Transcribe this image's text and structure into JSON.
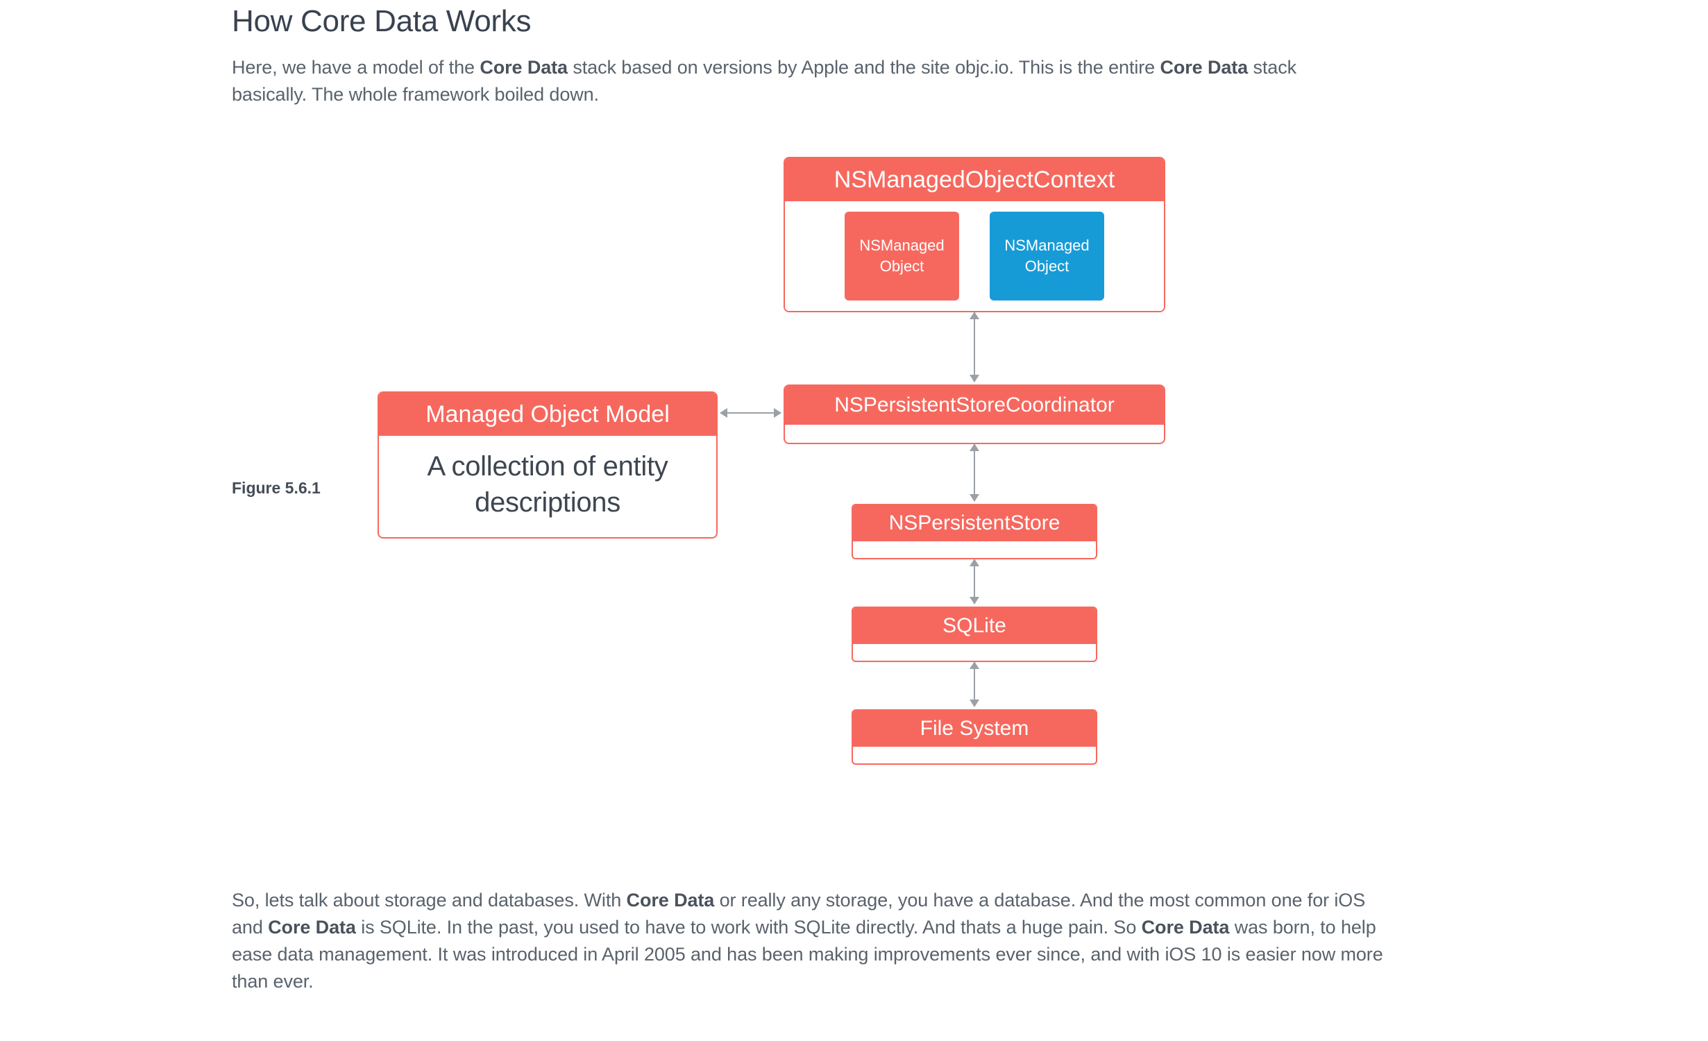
{
  "heading": "How Core Data Works",
  "intro": {
    "pre1": "Here, we have a model of the ",
    "bold1": "Core Data",
    "mid1": " stack based on versions by Apple and the site objc.io. This is the entire ",
    "bold2": "Core Data",
    "post1": " stack basically. The whole framework boiled down."
  },
  "figure_label": "Figure 5.6.1",
  "diagram": {
    "context": {
      "title": "NSManagedObjectContext",
      "inner_left": {
        "line1": "NSManaged",
        "line2": "Object"
      },
      "inner_right": {
        "line1": "NSManaged",
        "line2": "Object"
      }
    },
    "mom": {
      "title": "Managed Object Model",
      "body_line1": "A collection of entity",
      "body_line2": "descriptions"
    },
    "coordinator": {
      "title": "NSPersistentStoreCoordinator"
    },
    "store": {
      "title": "NSPersistentStore"
    },
    "sqlite": {
      "title": "SQLite"
    },
    "fs": {
      "title": "File System"
    }
  },
  "outro": {
    "t1": "So, lets talk about storage and databases. With ",
    "b1": "Core Data",
    "t2": " or really any storage, you have a database. And the most common one for iOS and ",
    "b2": "Core Data",
    "t3": " is SQLite. In the past, you used to have to work with SQLite directly. And thats a huge pain. So ",
    "b3": "Core Data",
    "t4": " was born, to help ease data management. It was introduced in April 2005 and has been making improvements ever since, and with iOS 10 is easier now more than ever."
  }
}
